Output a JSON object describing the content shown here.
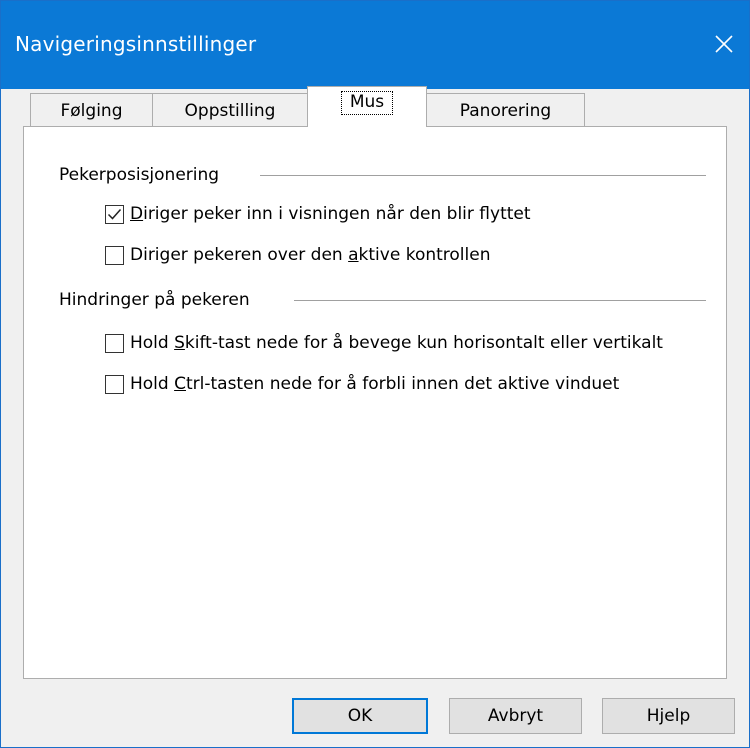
{
  "window": {
    "title": "Navigeringsinnstillinger"
  },
  "tabs": [
    {
      "label": "Følging"
    },
    {
      "label": "Oppstilling"
    },
    {
      "label": "Mus",
      "selected": true
    },
    {
      "label": "Panorering"
    }
  ],
  "groups": {
    "pointer_positioning": {
      "label": "Pekerposisjonering",
      "options": [
        {
          "label_hot": "D",
          "label_rest": "iriger peker inn i visningen når den blir flyttet",
          "checked": true
        },
        {
          "label_pre": "Diriger pekeren over den ",
          "label_hot": "a",
          "label_rest": "ktive kontrollen",
          "checked": false
        }
      ]
    },
    "pointer_constraints": {
      "label": "Hindringer på pekeren",
      "options": [
        {
          "label_pre": "Hold ",
          "label_hot": "S",
          "label_rest": "kift-tast nede for å bevege kun horisontalt eller vertikalt",
          "checked": false
        },
        {
          "label_pre": "Hold ",
          "label_hot": "C",
          "label_rest": "trl-tasten nede for å forbli innen det aktive vinduet",
          "checked": false
        }
      ]
    }
  },
  "buttons": {
    "ok": "OK",
    "cancel": "Avbryt",
    "help": "Hjelp"
  },
  "colors": {
    "titlebar": "#0b79d6",
    "default_button_border": "#0078d7"
  },
  "icons": {
    "close": "close-icon",
    "check": "checkmark-icon"
  }
}
